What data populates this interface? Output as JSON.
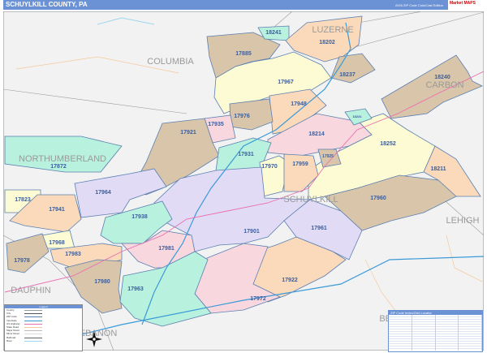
{
  "header": {
    "title": "SCHUYLKILL COUNTY, PA",
    "edition": "2026 ZIP Code ColorCast Edition",
    "logo_text": "Market MAPS"
  },
  "colors": {
    "tan": "#d9c5aa",
    "lavender": "#e2dbf6",
    "mint": "#b8f1dd",
    "yellow": "#fdfbd3",
    "pink": "#f9d7df",
    "peach": "#fbdabb",
    "interstate": "#3a9ad9",
    "highway": "#e86fb0",
    "header": "#6a92d4"
  },
  "counties": {
    "columbia": "COLUMBIA",
    "luzerne": "LUZERNE",
    "carbon": "CARBON",
    "northumberland": "NORTHUMBERLAND",
    "schuylkill": "SCHUYLKILL",
    "lehigh": "LEHIGH",
    "dauphin": "DAUPHIN",
    "berks": "BERKS",
    "lebanon": "LEBANON"
  },
  "zips": {
    "z18241": "18241",
    "z18202": "18202",
    "z17885": "17885",
    "z18237": "18237",
    "z17967": "17967",
    "z18240": "18240",
    "z17948": "17948",
    "z17976": "17976",
    "z17935": "17935",
    "z18214": "18214",
    "z18231": "18231",
    "z18252": "18252",
    "z17921": "17921",
    "z17931": "17931",
    "z17970": "17970",
    "z17959": "17959",
    "z17925": "17925",
    "z18211": "18211",
    "z17960": "17960",
    "z17901": "17901",
    "z17961": "17961",
    "z17922": "17922",
    "z17972": "17972",
    "z17872": "17872",
    "z17964": "17964",
    "z17823": "17823",
    "z17941": "17941",
    "z17938": "17938",
    "z17968": "17968",
    "z17983": "17983",
    "z17978": "17978",
    "z17981": "17981",
    "z17980": "17980",
    "z17963": "17963"
  },
  "legend": {
    "title": "Legend",
    "items": [
      "County",
      "City",
      "ZIP Code",
      "Interstate",
      "US Highway",
      "State Road",
      "Major Road",
      "Minor Road",
      "Railroad",
      "River"
    ]
  },
  "index": {
    "title": "ZIP Code Index/Grid Locator"
  }
}
